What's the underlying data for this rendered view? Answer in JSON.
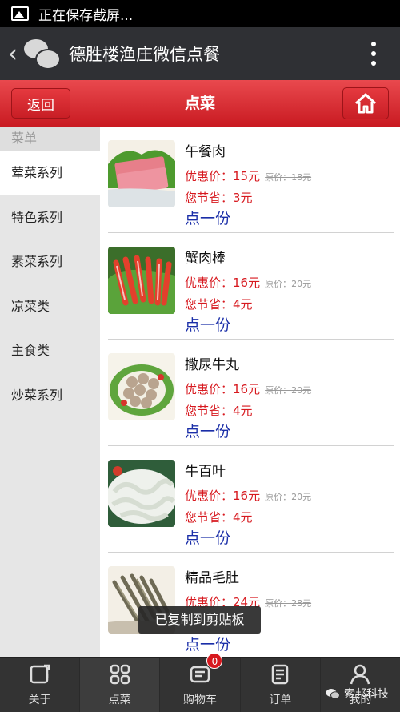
{
  "status_bar": {
    "text": "正在保存截屏..."
  },
  "wechat_bar": {
    "title": "德胜楼渔庄微信点餐"
  },
  "nav": {
    "back": "返回",
    "title": "点菜"
  },
  "sidebar": {
    "header": "菜单",
    "categories": [
      "荤菜系列",
      "特色系列",
      "素菜系列",
      "凉菜类",
      "主食类",
      "炒菜系列"
    ],
    "active_index": 0
  },
  "dishes": [
    {
      "name": "午餐肉",
      "price": "优惠价：15元",
      "orig": "原价：18元",
      "save": "您节省：3元",
      "order": "点一份"
    },
    {
      "name": "蟹肉棒",
      "price": "优惠价：16元",
      "orig": "原价：20元",
      "save": "您节省：4元",
      "order": "点一份"
    },
    {
      "name": "撒尿牛丸",
      "price": "优惠价：16元",
      "orig": "原价：20元",
      "save": "您节省：4元",
      "order": "点一份"
    },
    {
      "name": "牛百叶",
      "price": "优惠价：16元",
      "orig": "原价：20元",
      "save": "您节省：4元",
      "order": "点一份"
    },
    {
      "name": "精品毛肚",
      "price": "优惠价：24元",
      "orig": "原价：28元",
      "save": "",
      "order": "点一份"
    }
  ],
  "toast": "已复制到剪贴板",
  "tabbar": {
    "about": "关于",
    "menu": "点菜",
    "cart": "购物车",
    "cart_count": "0",
    "orders": "订单",
    "mine": "我的"
  },
  "watermark": "索邦科技",
  "colors": {
    "accent_red": "#d7191f",
    "link_blue": "#1a2ea8",
    "dark_bar": "#2f3034"
  }
}
